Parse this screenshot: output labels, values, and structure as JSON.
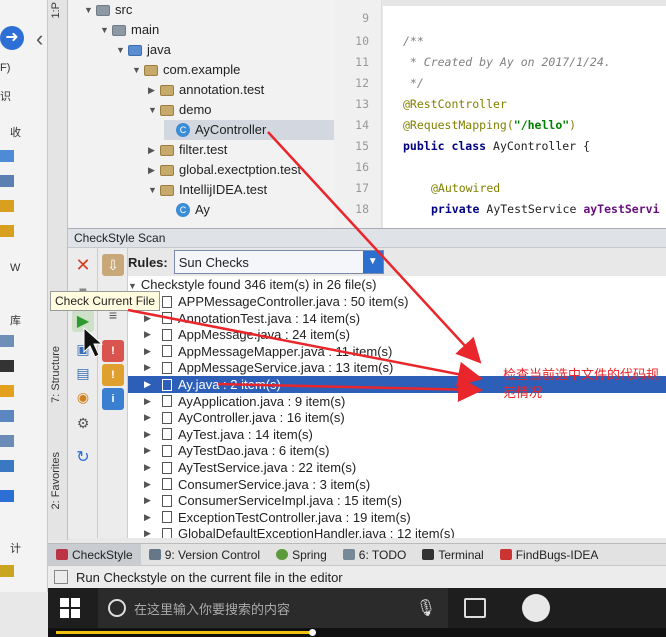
{
  "background_app": {
    "menu_fragments": [
      "F)",
      "识",
      "收",
      "W",
      "库",
      "计"
    ]
  },
  "left_tool_bar": {
    "tabs": [
      "1:P",
      "7: Structure",
      "2: Favorites"
    ]
  },
  "project_tree": {
    "items": [
      {
        "label": "src",
        "type": "folder"
      },
      {
        "label": "main",
        "type": "folder"
      },
      {
        "label": "java",
        "type": "folder"
      },
      {
        "label": "com.example",
        "type": "package"
      },
      {
        "label": "annotation.test",
        "type": "package"
      },
      {
        "label": "demo",
        "type": "package"
      },
      {
        "label": "AyController",
        "type": "class"
      },
      {
        "label": "filter.test",
        "type": "package"
      },
      {
        "label": "global.exectption.test",
        "type": "package"
      },
      {
        "label": "IntellijIDEA.test",
        "type": "package"
      },
      {
        "label": "Ay",
        "type": "class"
      }
    ]
  },
  "editor": {
    "line_numbers": [
      "9",
      "10",
      "11",
      "12",
      "13",
      "14",
      "15",
      "16",
      "17",
      "18"
    ],
    "lines": {
      "l10": "/**",
      "l11": " * Created by Ay on 2017/1/24.",
      "l12": " */",
      "l13": "@RestController",
      "l14a": "@RequestMapping(",
      "l14b": "\"/hello\"",
      "l14c": ")",
      "l15a": "public class ",
      "l15b": "AyController {",
      "l17": "@Autowired",
      "l18a": "private ",
      "l18b": "AyTestService ",
      "l18c": "ayTestServi"
    }
  },
  "checkstyle": {
    "panel_title": "CheckStyle Scan",
    "rules_label": "Rules:",
    "rules_value": "Sun Checks",
    "summary": "Checkstyle found 346 item(s) in 26 file(s)",
    "tooltip": "Check Current File",
    "results": [
      "APPMessageController.java : 50 item(s)",
      "AnnotationTest.java : 14 item(s)",
      "AppMessage.java : 24 item(s)",
      "AppMessageMapper.java : 11 item(s)",
      "AppMessageService.java : 13 item(s)",
      "Ay.java : 2 item(s)",
      "AyApplication.java : 9 item(s)",
      "AyController.java : 16 item(s)",
      "AyTest.java : 14 item(s)",
      "AyTestDao.java : 6 item(s)",
      "AyTestService.java : 22 item(s)",
      "ConsumerService.java : 3 item(s)",
      "ConsumerServiceImpl.java : 15 item(s)",
      "ExceptionTestController.java : 19 item(s)",
      "GlobalDefaultExceptionHandler.java : 12 item(s)"
    ],
    "selected_index": 5
  },
  "annotation": {
    "text": "检查当前选中文件的代码规范情况",
    "color": "#e8262b"
  },
  "bottom_tabs": [
    {
      "label": "CheckStyle",
      "active": true
    },
    {
      "label": "9: Version Control",
      "active": false
    },
    {
      "label": "Spring",
      "active": false
    },
    {
      "label": "6: TODO",
      "active": false
    },
    {
      "label": "Terminal",
      "active": false
    },
    {
      "label": "FindBugs-IDEA",
      "active": false
    }
  ],
  "status_bar": {
    "message": "Run Checkstyle on the current file in the editor"
  },
  "taskbar": {
    "search_placeholder": "在这里输入你要搜索的内容"
  },
  "icons": {
    "close": "close-icon",
    "run": "play-icon",
    "dropdown": "chevron-down-icon"
  },
  "media_progress": 0.42
}
